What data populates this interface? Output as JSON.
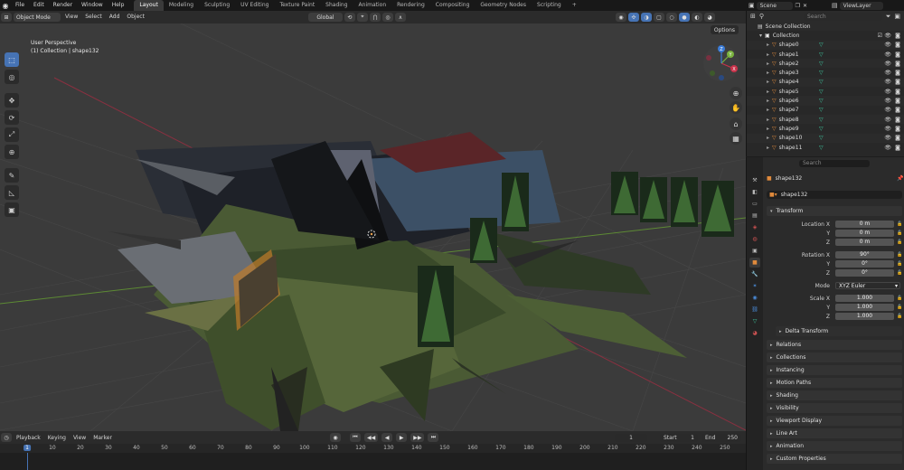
{
  "topbar": {
    "menus": [
      "File",
      "Edit",
      "Render",
      "Window",
      "Help"
    ],
    "workspaces": [
      "Layout",
      "Modeling",
      "Sculpting",
      "UV Editing",
      "Texture Paint",
      "Shading",
      "Animation",
      "Rendering",
      "Compositing",
      "Geometry Nodes",
      "Scripting"
    ],
    "active_workspace": "Layout",
    "add_workspace": "+",
    "scene": "Scene",
    "view_layer": "ViewLayer"
  },
  "viewport": {
    "mode": "Object Mode",
    "menus": [
      "View",
      "Select",
      "Add",
      "Object"
    ],
    "transform_orientation": "Global",
    "options": "Options",
    "overlay_title": "User Perspective",
    "overlay_subtitle": "(1) Collection | shape132",
    "gizmo_axes": {
      "x": "X",
      "y": "Y",
      "z": "Z"
    }
  },
  "timeline": {
    "menus": [
      "Playback",
      "Keying",
      "View",
      "Marker"
    ],
    "current_frame": "1",
    "start_label": "Start",
    "start": "1",
    "end_label": "End",
    "end": "250",
    "ticks": [
      "1",
      "10",
      "20",
      "30",
      "40",
      "50",
      "60",
      "70",
      "80",
      "90",
      "100",
      "110",
      "120",
      "130",
      "140",
      "150",
      "160",
      "170",
      "180",
      "190",
      "200",
      "210",
      "220",
      "230",
      "240",
      "250"
    ]
  },
  "outliner": {
    "search_placeholder": "Search",
    "root": "Scene Collection",
    "collection": "Collection",
    "items": [
      "shape0",
      "shape1",
      "shape2",
      "shape3",
      "shape4",
      "shape5",
      "shape6",
      "shape7",
      "shape8",
      "shape9",
      "shape10",
      "shape11"
    ]
  },
  "properties": {
    "search_placeholder": "Search",
    "object_name": "shape132",
    "object_datablock": "shape132",
    "transform_title": "Transform",
    "location_label": "Location X",
    "location": [
      "0 m",
      "0 m",
      "0 m"
    ],
    "rotation_label": "Rotation X",
    "rotation": [
      "90°",
      "0°",
      "0°"
    ],
    "mode_label": "Mode",
    "mode_value": "XYZ Euler",
    "scale_label": "Scale X",
    "scale": [
      "1.000",
      "1.000",
      "1.000"
    ],
    "y_label": "Y",
    "z_label": "Z",
    "delta_transform": "Delta Transform",
    "panels": [
      "Relations",
      "Collections",
      "Instancing",
      "Motion Paths",
      "Shading",
      "Visibility",
      "Viewport Display",
      "Line Art",
      "Animation",
      "Custom Properties"
    ]
  },
  "colors": {
    "accent": "#4673b4",
    "x_axis": "#c8324a",
    "y_axis": "#7ab33e",
    "z_axis": "#3a7bd6",
    "mesh": "#3ec8a0",
    "object": "#e08a3c"
  }
}
